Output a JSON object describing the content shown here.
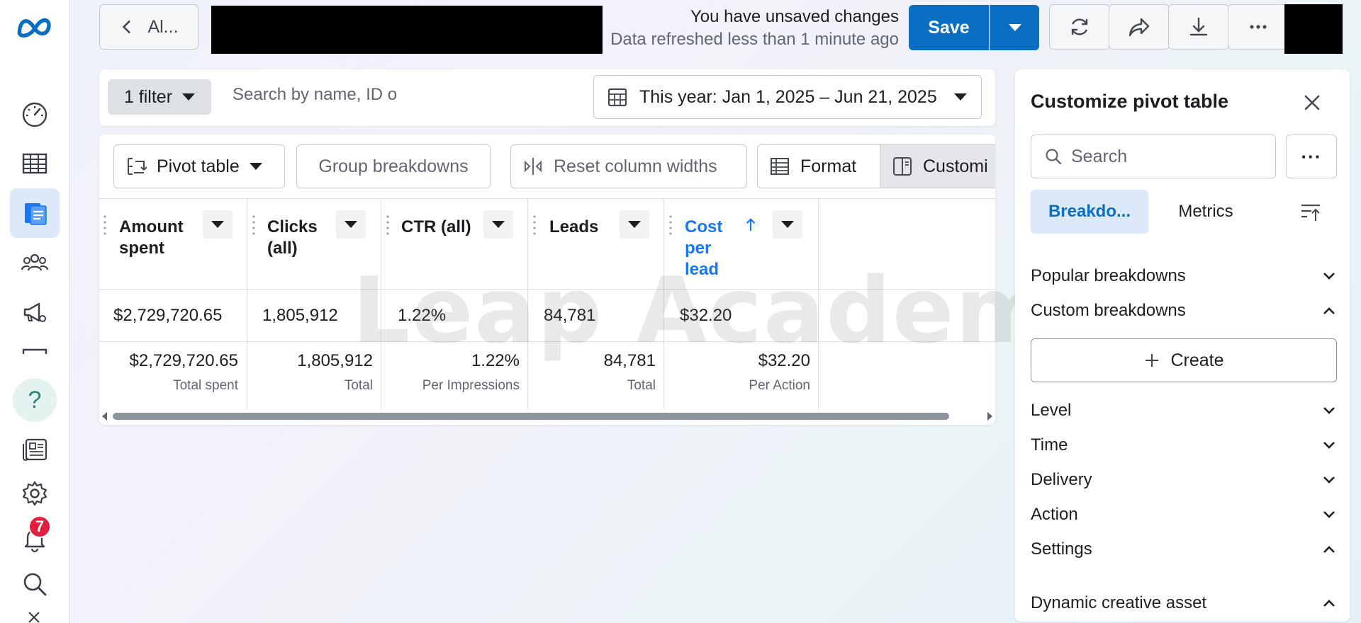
{
  "nav": {
    "items": [
      {
        "name": "dashboard-icon"
      },
      {
        "name": "table-icon"
      },
      {
        "name": "reports-icon",
        "active": true
      },
      {
        "name": "audiences-icon"
      },
      {
        "name": "campaign-icon"
      },
      {
        "name": "divider-icon"
      },
      {
        "name": "help-icon",
        "glyph": "?"
      },
      {
        "name": "news-icon"
      },
      {
        "name": "settings-icon"
      },
      {
        "name": "notifications-icon",
        "badge": "7"
      },
      {
        "name": "search-icon"
      }
    ]
  },
  "topbar": {
    "back_label": "Al...",
    "unsaved_text": "You have unsaved changes",
    "refreshed_text": "Data refreshed less than 1 minute ago",
    "save_label": "Save"
  },
  "filters": {
    "chip_label": "1 filter",
    "search_placeholder": "Search by name, ID o",
    "date_range": "This year: Jan 1, 2025 – Jun 21, 2025"
  },
  "toolbar": {
    "pivot_label": "Pivot table",
    "group_label": "Group breakdowns",
    "reset_label": "Reset column widths",
    "format_label": "Format",
    "customize_label": "Customi"
  },
  "table": {
    "columns": [
      {
        "label": "Amount spent",
        "value": "$2,729,720.65",
        "total": "$2,729,720.65",
        "total_label": "Total spent"
      },
      {
        "label": "Clicks (all)",
        "value": "1,805,912",
        "total": "1,805,912",
        "total_label": "Total"
      },
      {
        "label": "CTR (all)",
        "value": "1.22%",
        "total": "1.22%",
        "total_label": "Per Impressions"
      },
      {
        "label": "Leads",
        "value": "84,781",
        "total": "84,781",
        "total_label": "Total"
      },
      {
        "label": "Cost per lead",
        "value": "$32.20",
        "total": "$32.20",
        "total_label": "Per Action",
        "sorted": "ascending"
      }
    ],
    "watermark": "Leap Academy"
  },
  "side_panel": {
    "title": "Customize pivot table",
    "search_placeholder": "Search",
    "more_label": "···",
    "tabs": {
      "breakdowns": "Breakdo...",
      "metrics": "Metrics"
    },
    "sections": {
      "popular": "Popular breakdowns",
      "custom": "Custom breakdowns",
      "create": "Create",
      "level": "Level",
      "time": "Time",
      "delivery": "Delivery",
      "action": "Action",
      "settings": "Settings",
      "dynamic": "Dynamic creative asset"
    }
  },
  "colors": {
    "accent": "#0a6fc2",
    "active_tab_bg": "#dbe9fb",
    "badge": "#e41e3f",
    "sorted_column": "#1877f2"
  }
}
